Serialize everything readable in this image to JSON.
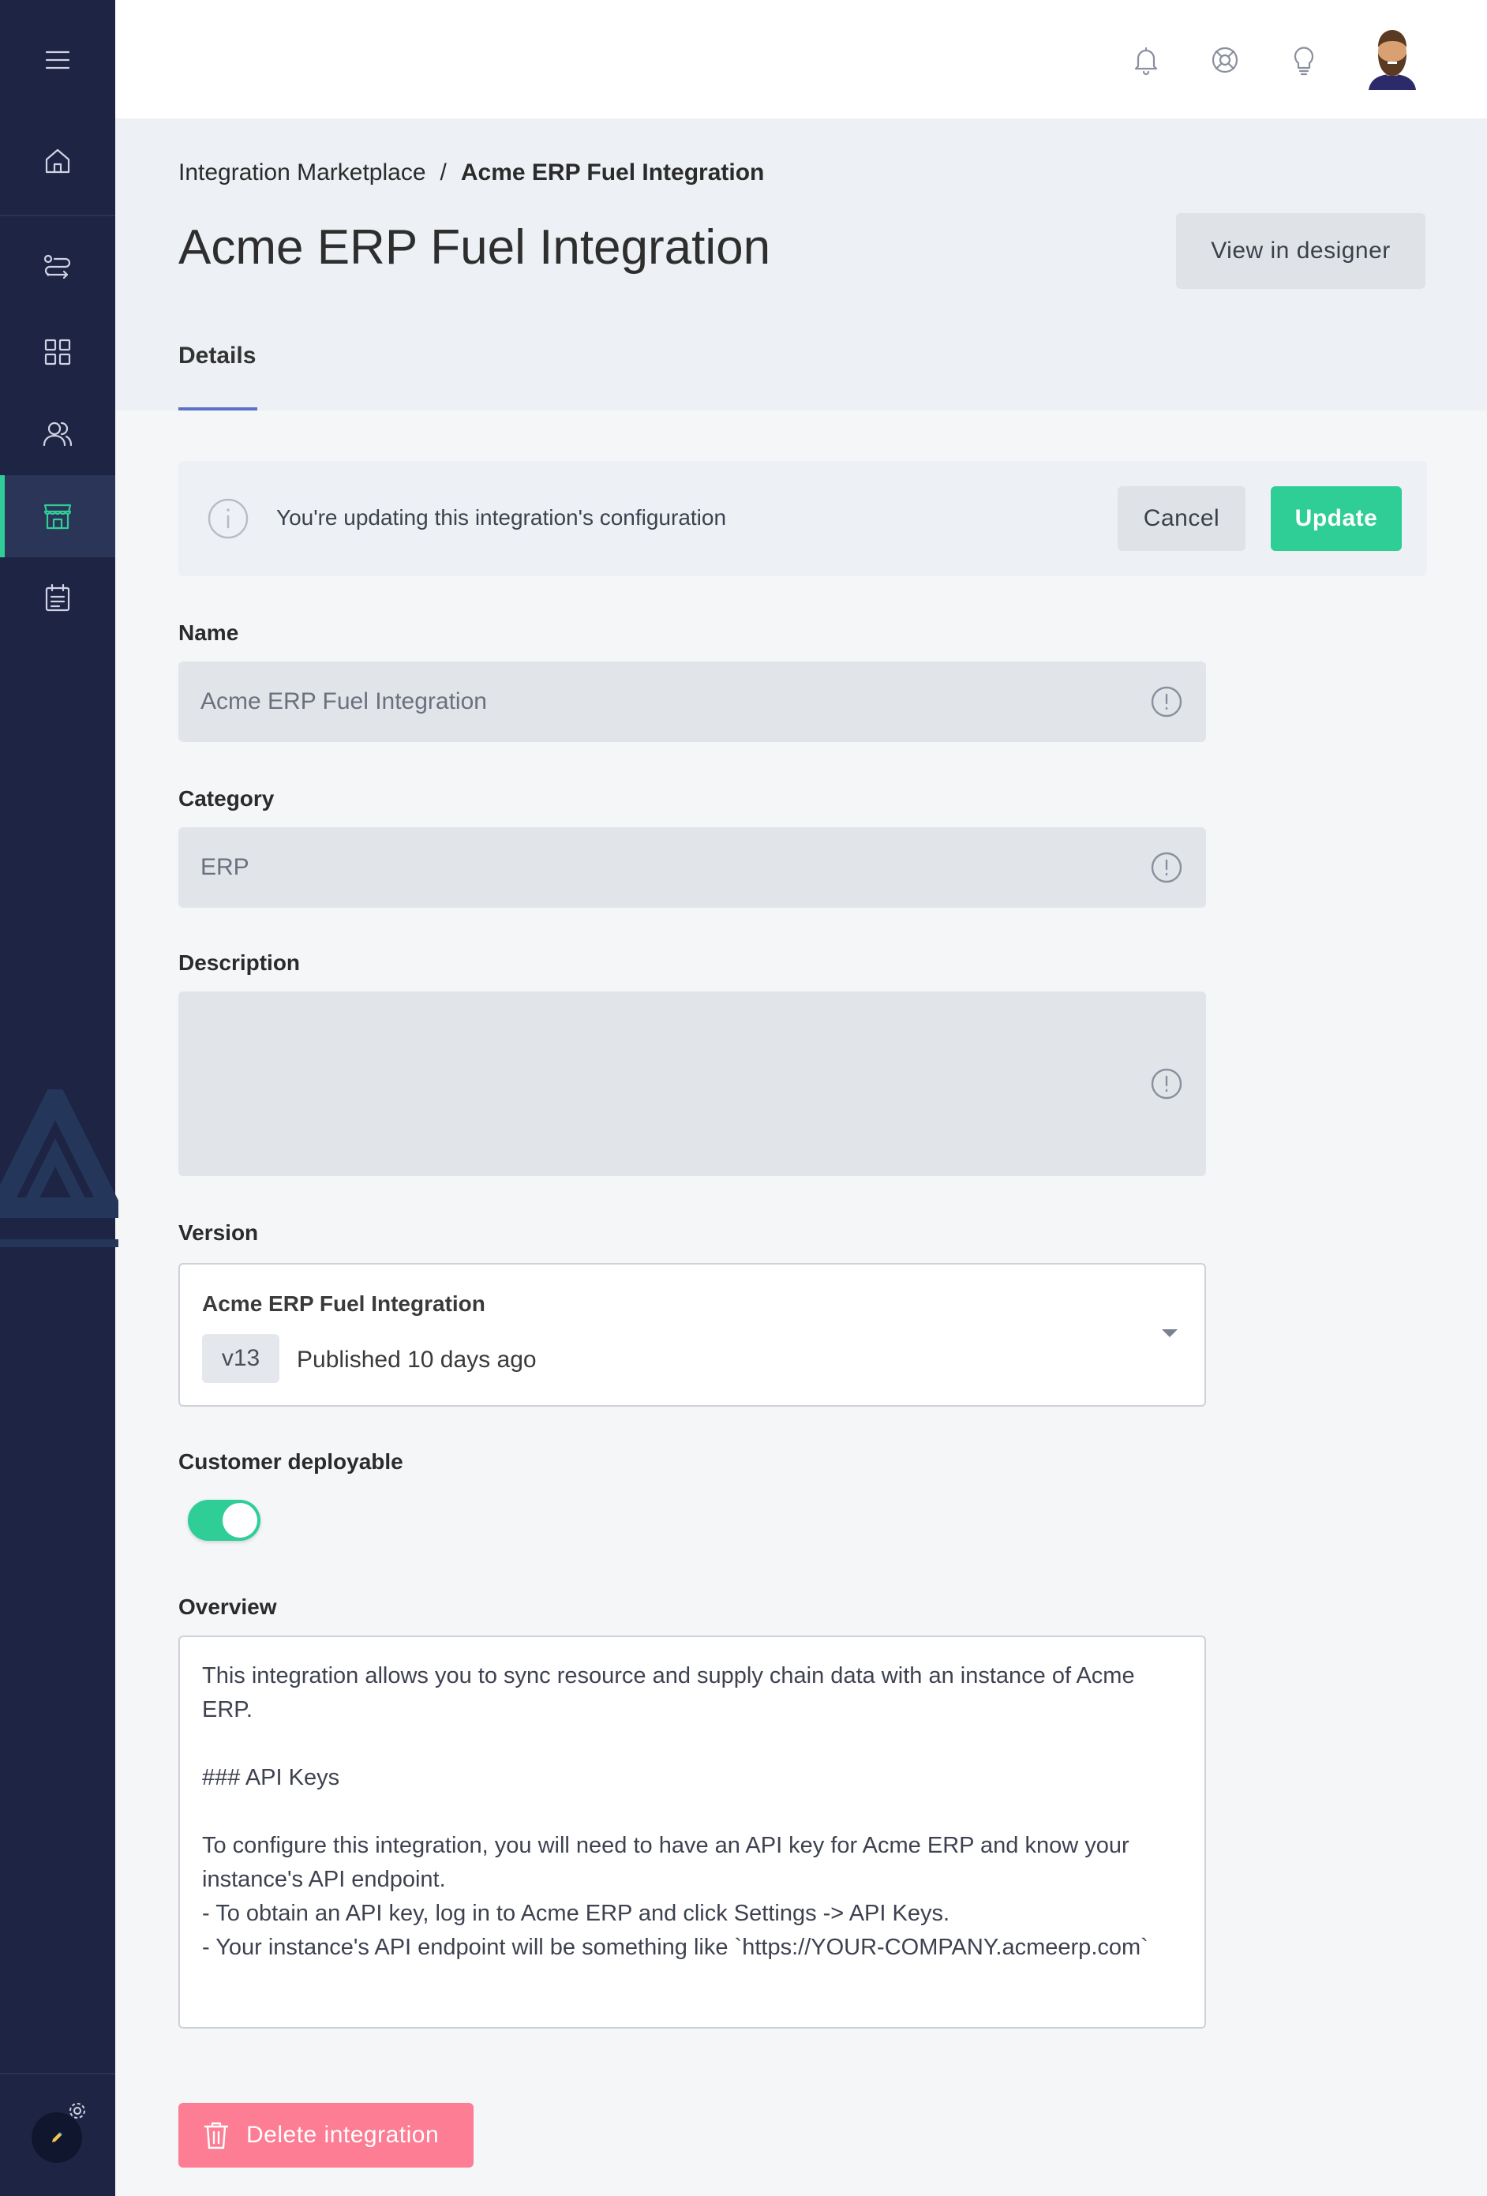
{
  "sidebar": {
    "items": [
      {
        "icon": "menu-icon"
      },
      {
        "icon": "home-icon"
      },
      {
        "icon": "integrations-icon"
      },
      {
        "icon": "dashboard-icon"
      },
      {
        "icon": "users-icon"
      },
      {
        "icon": "marketplace-icon",
        "active": true
      },
      {
        "icon": "logs-icon"
      }
    ],
    "accent_color": "#2fce97",
    "background_color": "#1e2443"
  },
  "topbar": {
    "icons": [
      "bell-icon",
      "help-lifebuoy-icon",
      "lightbulb-icon",
      "user-avatar"
    ]
  },
  "breadcrumb": {
    "parent": "Integration Marketplace",
    "separator": "/",
    "current": "Acme ERP Fuel Integration"
  },
  "page": {
    "title": "Acme ERP Fuel Integration",
    "view_in_designer_label": "View in designer",
    "tab_details": "Details"
  },
  "banner": {
    "message": "You're updating this integration's configuration",
    "cancel_label": "Cancel",
    "update_label": "Update"
  },
  "form": {
    "name_label": "Name",
    "name_value": "Acme ERP Fuel Integration",
    "category_label": "Category",
    "category_value": "ERP",
    "description_label": "Description",
    "description_value": "",
    "version_label": "Version",
    "version_name": "Acme ERP Fuel Integration",
    "version_tag": "v13",
    "version_status": "Published 10 days ago",
    "customer_deployable_label": "Customer deployable",
    "customer_deployable": true,
    "overview_label": "Overview",
    "overview_value": "This integration allows you to sync resource and supply chain data with an instance of Acme ERP.\n\n### API Keys\n\nTo configure this integration, you will need to have an API key for Acme ERP and know your instance's API endpoint.\n- To obtain an API key, log in to Acme ERP and click Settings -> API Keys.\n- Your instance's API endpoint will be something like `https://YOUR-COMPANY.acmeerp.com`"
  },
  "delete_label": "Delete integration",
  "colors": {
    "primary_green": "#2fce97",
    "danger_pink": "#fd7d94",
    "tab_underline": "#5b72c6"
  }
}
